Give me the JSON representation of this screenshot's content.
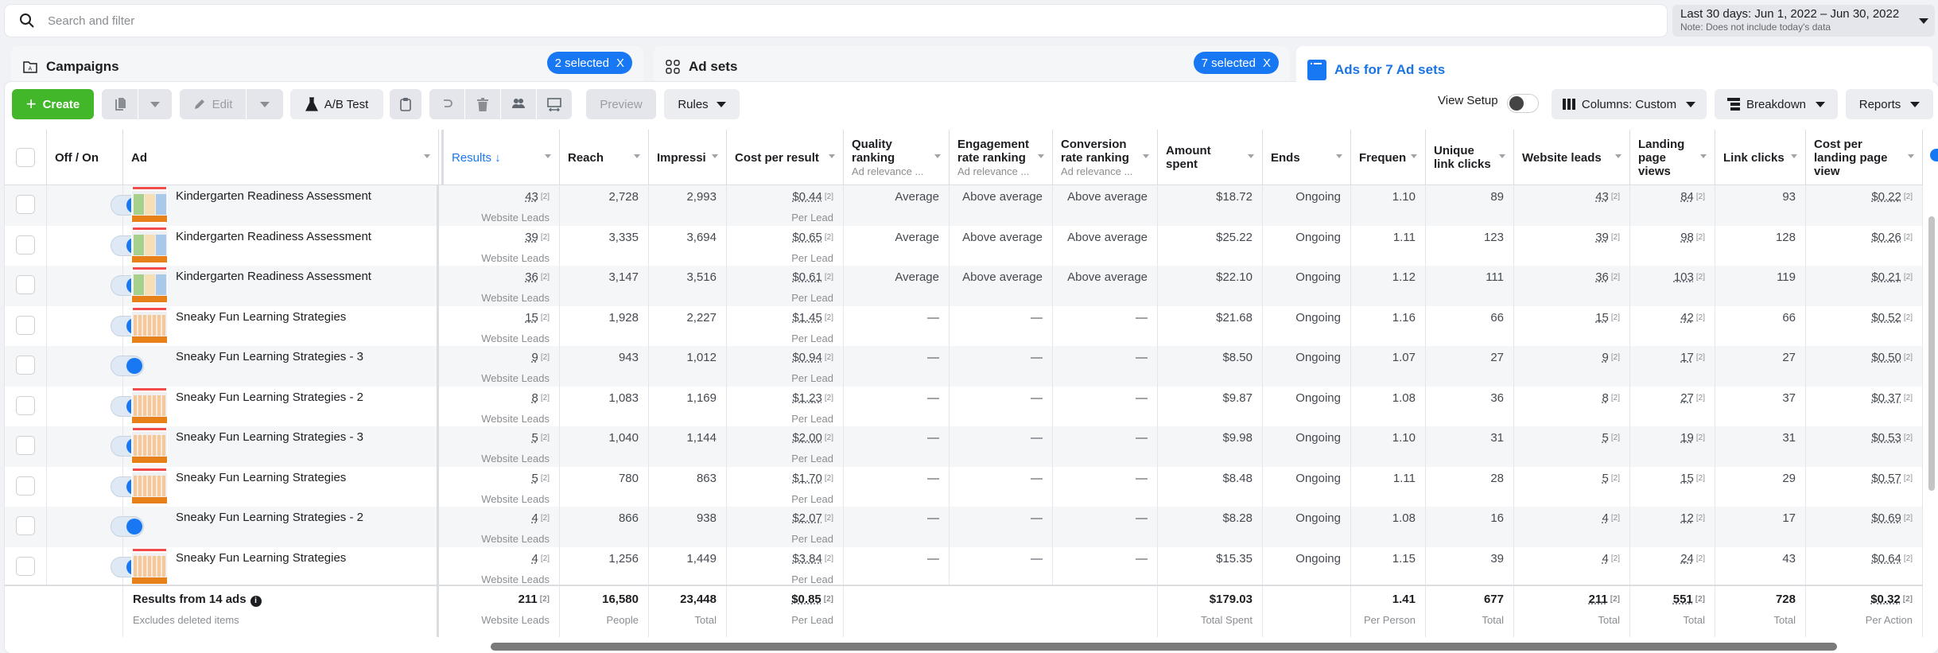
{
  "search": {
    "placeholder": "Search and filter"
  },
  "date_range": {
    "label": "Last 30 days: Jun 1, 2022 – Jun 30, 2022",
    "note": "Note: Does not include today's data"
  },
  "level_tabs": [
    {
      "label": "Campaigns",
      "selected_label": "2 selected",
      "close": "X"
    },
    {
      "label": "Ad sets",
      "selected_label": "7 selected",
      "close": "X"
    },
    {
      "label": "Ads for 7 Ad sets"
    }
  ],
  "toolbar": {
    "create": "Create",
    "edit": "Edit",
    "ab_test": "A/B Test",
    "preview": "Preview",
    "rules": "Rules",
    "view_setup": "View Setup",
    "columns": "Columns: Custom",
    "breakdown": "Breakdown",
    "reports": "Reports"
  },
  "columns": [
    {
      "key": "offon",
      "label": "Off / On"
    },
    {
      "key": "ad",
      "label": "Ad"
    },
    {
      "key": "results",
      "label": "Results ↓"
    },
    {
      "key": "reach",
      "label": "Reach"
    },
    {
      "key": "impressions",
      "label": "Impressi"
    },
    {
      "key": "cpr",
      "label": "Cost per result"
    },
    {
      "key": "quality",
      "label": "Quality ranking",
      "sub": "Ad relevance ..."
    },
    {
      "key": "engagement",
      "label": "Engagement rate ranking",
      "sub": "Ad relevance ..."
    },
    {
      "key": "conversion",
      "label": "Conversion rate ranking",
      "sub": "Ad relevance ..."
    },
    {
      "key": "spent",
      "label": "Amount spent"
    },
    {
      "key": "ends",
      "label": "Ends"
    },
    {
      "key": "frequency",
      "label": "Frequen"
    },
    {
      "key": "ulc",
      "label": "Unique link clicks"
    },
    {
      "key": "leads",
      "label": "Website leads"
    },
    {
      "key": "lpv",
      "label": "Landing page views"
    },
    {
      "key": "clicks",
      "label": "Link clicks"
    },
    {
      "key": "cplpv",
      "label": "Cost per landing page view"
    }
  ],
  "result_sub": "Website Leads",
  "cpr_sub": "Per Lead",
  "footnote": "[2]",
  "rows": [
    {
      "ad": "Kindergarten Readiness Assessment",
      "thumb": "kindergarten",
      "results": "43",
      "reach": "2,728",
      "impressions": "2,993",
      "cpr": "$0.44",
      "quality": "Average",
      "engagement": "Above average",
      "conversion": "Above average",
      "spent": "$18.72",
      "ends": "Ongoing",
      "frequency": "1.10",
      "ulc": "89",
      "leads": "43",
      "lpv": "84",
      "clicks": "93",
      "cplpv": "$0.22"
    },
    {
      "ad": "Kindergarten Readiness Assessment",
      "thumb": "kindergarten",
      "results": "39",
      "reach": "3,335",
      "impressions": "3,694",
      "cpr": "$0.65",
      "quality": "Average",
      "engagement": "Above average",
      "conversion": "Above average",
      "spent": "$25.22",
      "ends": "Ongoing",
      "frequency": "1.11",
      "ulc": "123",
      "leads": "39",
      "lpv": "98",
      "clicks": "128",
      "cplpv": "$0.26"
    },
    {
      "ad": "Kindergarten Readiness Assessment",
      "thumb": "kindergarten",
      "results": "36",
      "reach": "3,147",
      "impressions": "3,516",
      "cpr": "$0.61",
      "quality": "Average",
      "engagement": "Above average",
      "conversion": "Above average",
      "spent": "$22.10",
      "ends": "Ongoing",
      "frequency": "1.12",
      "ulc": "111",
      "leads": "36",
      "lpv": "103",
      "clicks": "119",
      "cplpv": "$0.21"
    },
    {
      "ad": "Sneaky Fun Learning Strategies",
      "thumb": "sneaky",
      "results": "15",
      "reach": "1,928",
      "impressions": "2,227",
      "cpr": "$1.45",
      "quality": "—",
      "engagement": "—",
      "conversion": "—",
      "spent": "$21.68",
      "ends": "Ongoing",
      "frequency": "1.16",
      "ulc": "66",
      "leads": "15",
      "lpv": "42",
      "clicks": "66",
      "cplpv": "$0.52"
    },
    {
      "ad": "Sneaky Fun Learning Strategies - 3",
      "thumb": "none",
      "results": "9",
      "reach": "943",
      "impressions": "1,012",
      "cpr": "$0.94",
      "quality": "—",
      "engagement": "—",
      "conversion": "—",
      "spent": "$8.50",
      "ends": "Ongoing",
      "frequency": "1.07",
      "ulc": "27",
      "leads": "9",
      "lpv": "17",
      "clicks": "27",
      "cplpv": "$0.50"
    },
    {
      "ad": "Sneaky Fun Learning Strategies - 2",
      "thumb": "sneaky",
      "results": "8",
      "reach": "1,083",
      "impressions": "1,169",
      "cpr": "$1.23",
      "quality": "—",
      "engagement": "—",
      "conversion": "—",
      "spent": "$9.87",
      "ends": "Ongoing",
      "frequency": "1.08",
      "ulc": "36",
      "leads": "8",
      "lpv": "27",
      "clicks": "37",
      "cplpv": "$0.37"
    },
    {
      "ad": "Sneaky Fun Learning Strategies - 3",
      "thumb": "sneaky",
      "results": "5",
      "reach": "1,040",
      "impressions": "1,144",
      "cpr": "$2.00",
      "quality": "—",
      "engagement": "—",
      "conversion": "—",
      "spent": "$9.98",
      "ends": "Ongoing",
      "frequency": "1.10",
      "ulc": "31",
      "leads": "5",
      "lpv": "19",
      "clicks": "31",
      "cplpv": "$0.53"
    },
    {
      "ad": "Sneaky Fun Learning Strategies",
      "thumb": "sneaky",
      "results": "5",
      "reach": "780",
      "impressions": "863",
      "cpr": "$1.70",
      "quality": "—",
      "engagement": "—",
      "conversion": "—",
      "spent": "$8.48",
      "ends": "Ongoing",
      "frequency": "1.11",
      "ulc": "28",
      "leads": "5",
      "lpv": "15",
      "clicks": "29",
      "cplpv": "$0.57"
    },
    {
      "ad": "Sneaky Fun Learning Strategies - 2",
      "thumb": "none",
      "results": "4",
      "reach": "866",
      "impressions": "938",
      "cpr": "$2.07",
      "quality": "—",
      "engagement": "—",
      "conversion": "—",
      "spent": "$8.28",
      "ends": "Ongoing",
      "frequency": "1.08",
      "ulc": "16",
      "leads": "4",
      "lpv": "12",
      "clicks": "17",
      "cplpv": "$0.69"
    },
    {
      "ad": "Sneaky Fun Learning Strategies",
      "thumb": "sneaky",
      "results": "4",
      "reach": "1,256",
      "impressions": "1,449",
      "cpr": "$3.84",
      "quality": "—",
      "engagement": "—",
      "conversion": "—",
      "spent": "$15.35",
      "ends": "Ongoing",
      "frequency": "1.15",
      "ulc": "39",
      "leads": "4",
      "lpv": "24",
      "clicks": "43",
      "cplpv": "$0.64"
    }
  ],
  "summary": {
    "title": "Results from 14 ads",
    "subtitle": "Excludes deleted items",
    "results": "211",
    "results_sub": "Website Leads",
    "reach": "16,580",
    "reach_sub": "People",
    "impressions": "23,448",
    "impressions_sub": "Total",
    "cpr": "$0.85",
    "cpr_sub": "Per Lead",
    "spent": "$179.03",
    "spent_sub": "Total Spent",
    "frequency": "1.41",
    "frequency_sub": "Per Person",
    "ulc": "677",
    "ulc_sub": "Total",
    "leads": "211",
    "leads_sub": "Total",
    "lpv": "551",
    "lpv_sub": "Total",
    "clicks": "728",
    "clicks_sub": "Total",
    "cplpv": "$0.32",
    "cplpv_sub": "Per Action"
  },
  "colors": {
    "accent": "#1877f2",
    "create": "#42b72a"
  }
}
